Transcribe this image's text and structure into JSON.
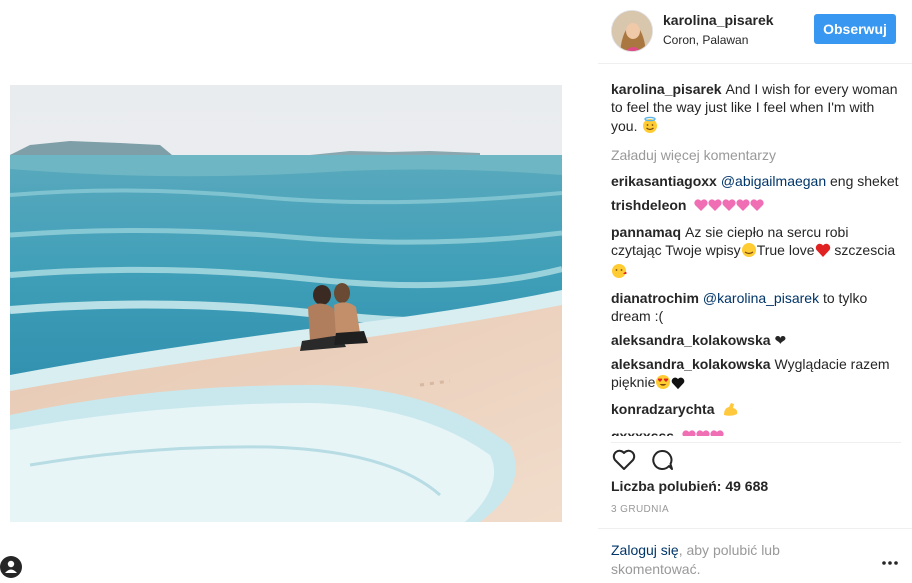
{
  "post": {
    "author": "karolina_pisarek",
    "location": "Coron, Palawan",
    "follow_label": "Obserwuj",
    "caption_user": "karolina_pisarek",
    "caption_text": "And I wish for every woman to feel the way just like I feel when I'm with you.",
    "load_more_label": "Załaduj więcej komentarzy",
    "likes_label": "Liczba polubień: 49 688",
    "date": "3 GRUDNIA",
    "login_link": "Zaloguj się",
    "login_rest": ", aby polubić lub skomentować."
  },
  "comments": [
    {
      "user": "erikasantiagoxx",
      "mention": "@abigailmaegan",
      "text": " eng sheket"
    },
    {
      "user": "trishdeleon",
      "text": "",
      "emoji": "hearts"
    },
    {
      "user": "pannamaq",
      "text": "Az sie ciepło na sercu robi czytając Twoje wpisy",
      "text2": "True love",
      "text3": "szczescia"
    },
    {
      "user": "dianatrochim",
      "mention": "@karolina_pisarek",
      "text": " to tylko dream :("
    },
    {
      "user": "aleksandra_kolakowska",
      "text": "❤"
    },
    {
      "user": "aleksandra_kolakowska",
      "text": "Wyglądacie razem pięknie"
    },
    {
      "user": "konradzarychta",
      "text": ""
    },
    {
      "user": "gxxxxsss",
      "text": ""
    }
  ],
  "icons": {
    "like": "heart-outline-icon",
    "comment": "speech-bubble-icon",
    "more": "ellipsis-icon",
    "user_tag": "person-tag-icon"
  },
  "colors": {
    "accent": "#3897f0",
    "link": "#003569",
    "muted": "#999999",
    "sea": "#3f9fb8",
    "sand": "#ecd6c1"
  }
}
